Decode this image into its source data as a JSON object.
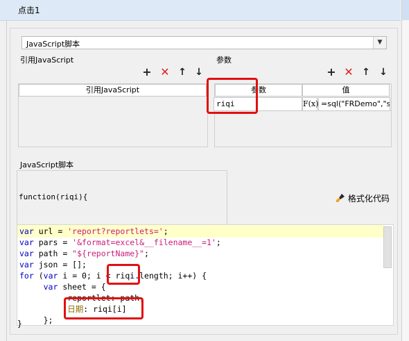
{
  "title": "点击1",
  "script_type_select": {
    "value": "JavaScript脚本"
  },
  "ref_js": {
    "label": "引用JavaScript",
    "column": "引用JavaScript"
  },
  "params": {
    "label": "参数",
    "col_param": "参数",
    "col_value": "值",
    "rows": [
      {
        "name": "riqi",
        "fx": "F(x)",
        "value": "=sql(\"FRDemo\",\"s"
      }
    ]
  },
  "toolbar": {
    "add": "+",
    "delete": "✕",
    "up": "↑",
    "down": "↓"
  },
  "script_section": {
    "label": "JavaScript脚本",
    "signature": "function(riqi){",
    "format_label": "格式化代码",
    "closing": "}"
  },
  "code_lines": [
    {
      "kw": "var",
      "rest": " url = ",
      "str": "'report?reportlets='",
      "tail": ";"
    },
    {
      "kw": "var",
      "rest": " pars = ",
      "str": "'&format=excel&__filename__=1'",
      "tail": ";"
    },
    {
      "kw": "var",
      "rest": " path = ",
      "str": "\"${reportName}\"",
      "tail": ";"
    },
    {
      "kw": "var",
      "rest": " json = [];",
      "str": "",
      "tail": ""
    },
    {
      "kw": "for",
      "rest": " (",
      "kw2": "var",
      "rest2": " i = 0; i < riqi.length; i++) {"
    },
    {
      "indent": "     ",
      "kw": "var",
      "rest": " sheet = {"
    },
    {
      "indent": "          ",
      "text": "reportlet: path,"
    },
    {
      "indent": "          ",
      "ch": "日期",
      "rest": ": riqi[i]"
    },
    {
      "indent": "     ",
      "text": "};"
    }
  ],
  "colors": {
    "keyword": "#0000c0",
    "string": "#c81e78",
    "highlight": "#ffffc8",
    "red_box": "#e01010"
  }
}
